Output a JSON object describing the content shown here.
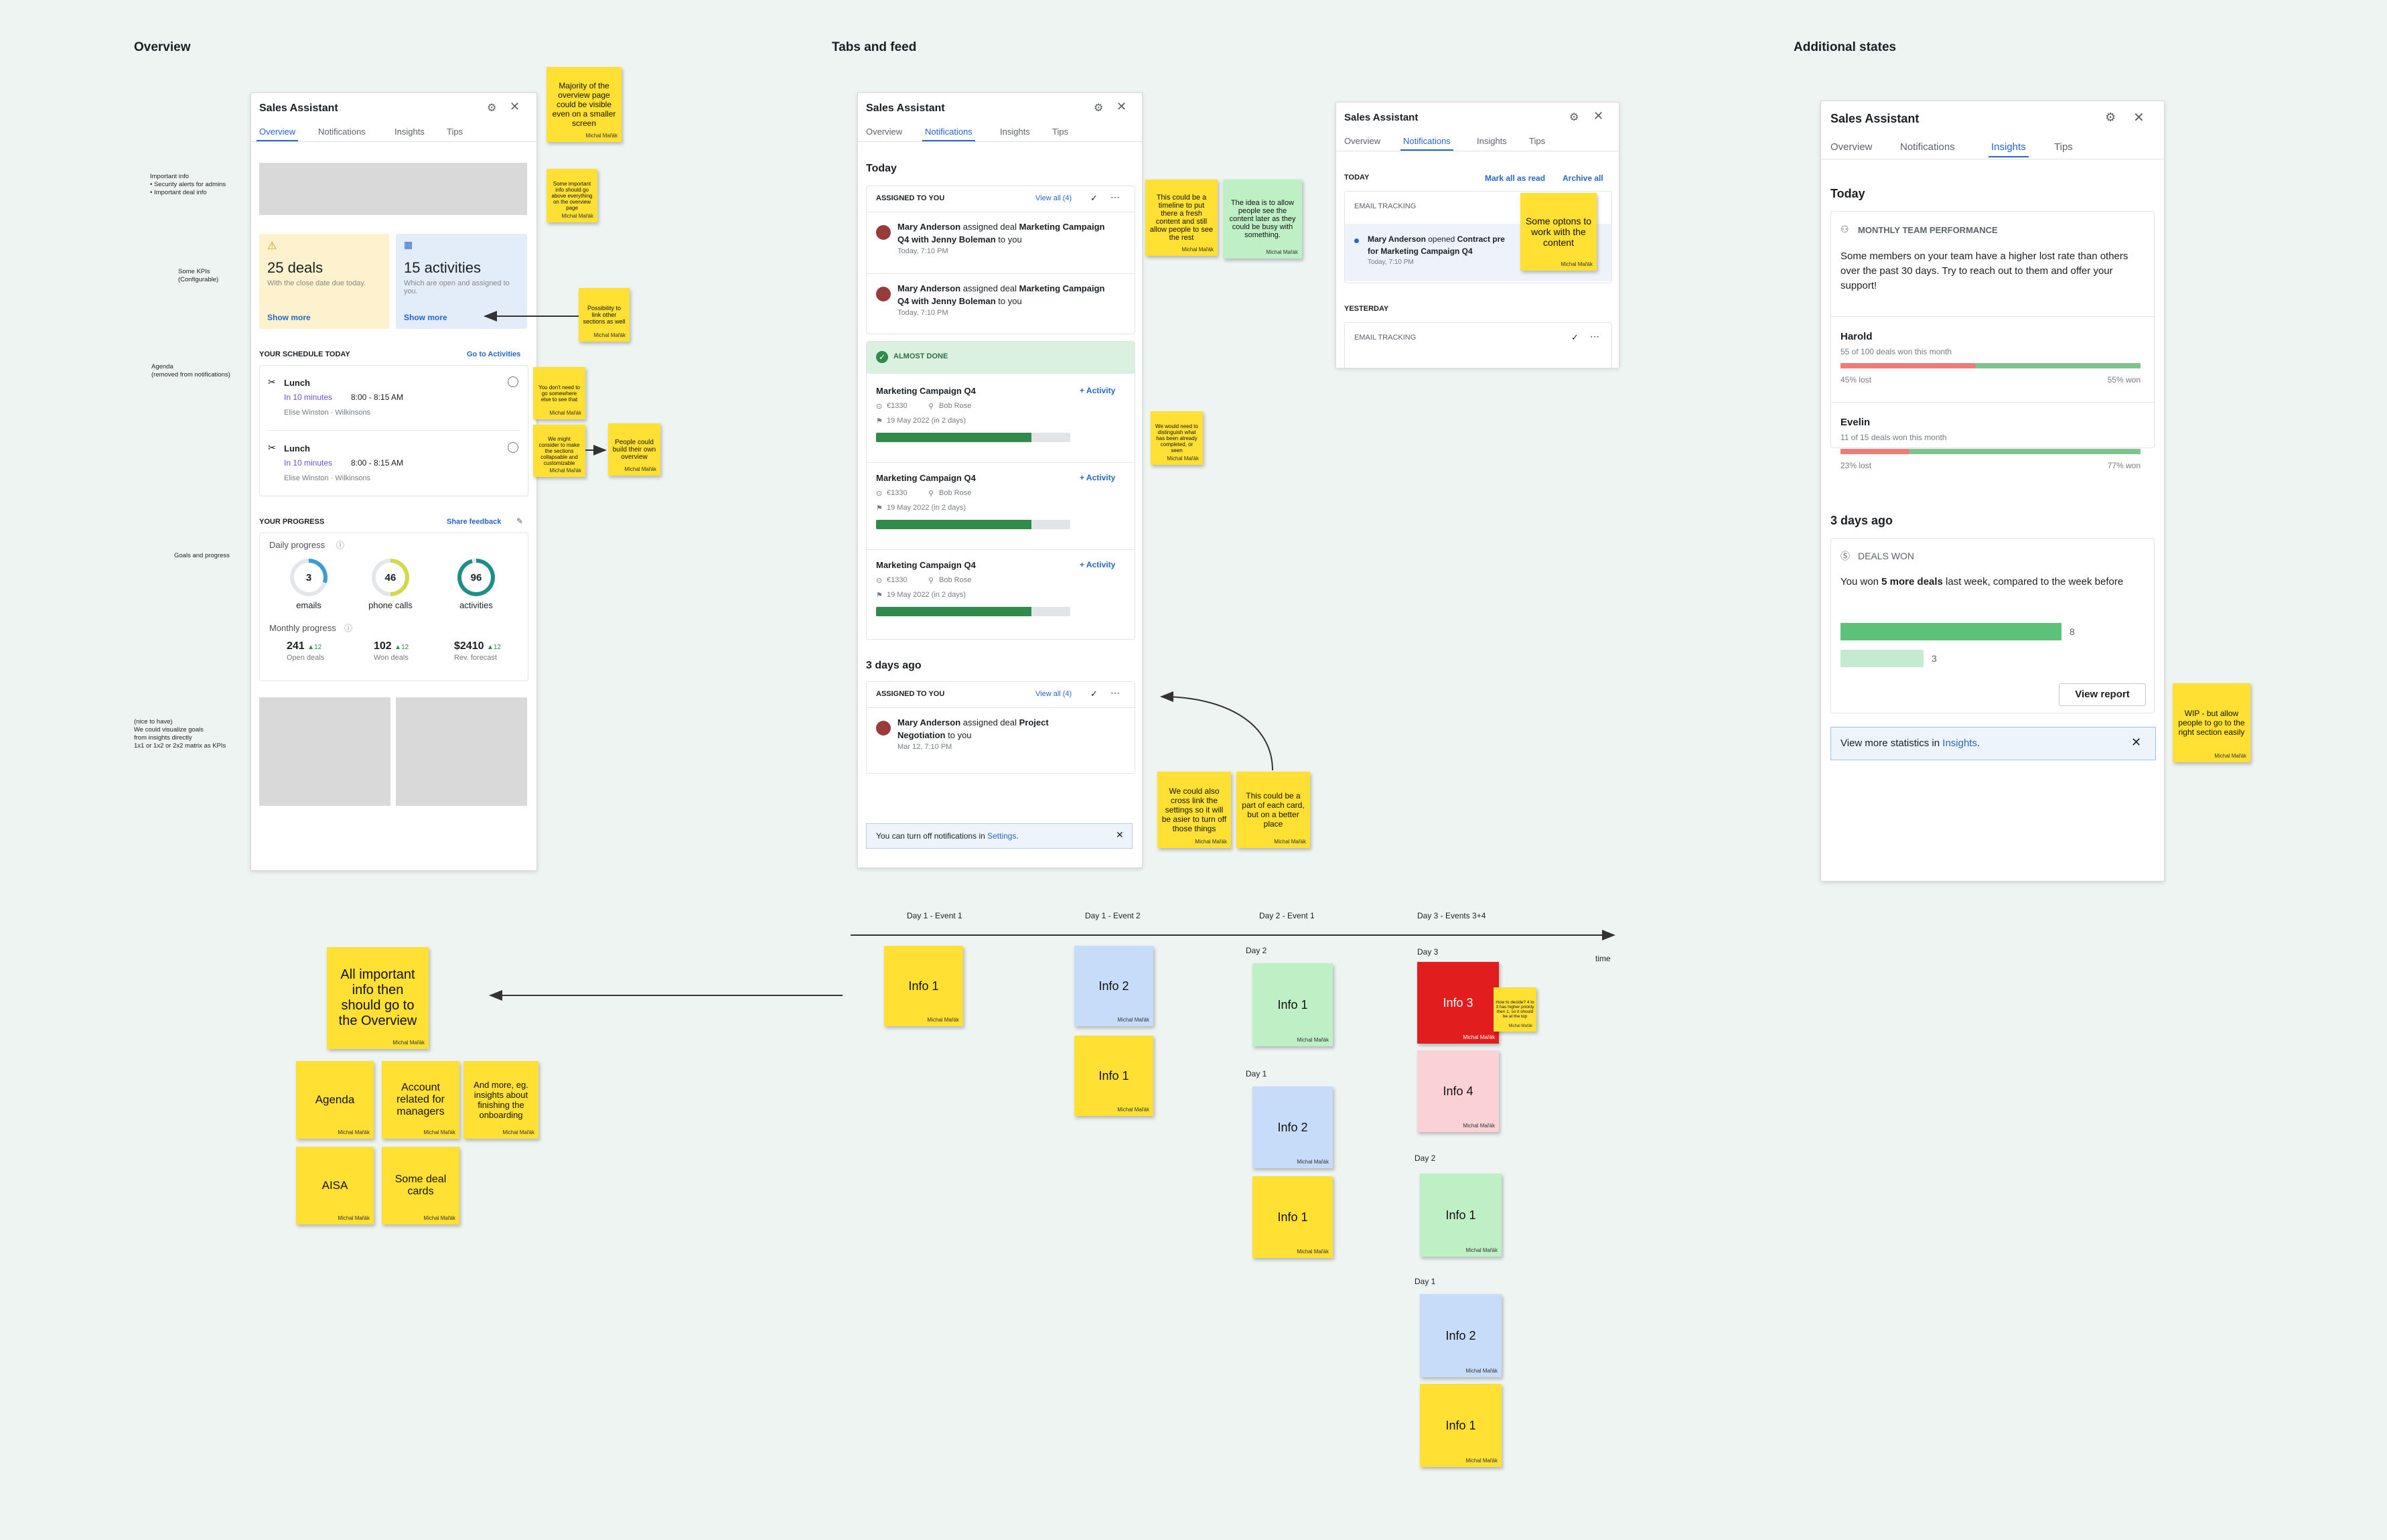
{
  "sections": {
    "overview": "Overview",
    "tabs_feed": "Tabs and feed",
    "additional": "Additional states"
  },
  "margin_notes": {
    "important": "Important info\n• Security alerts for admins\n• Important deal info",
    "kpis": "Some KPIs\n(Configurable)",
    "agenda": "Agenda\n(removed from notifications)",
    "goals": "Goals and progress",
    "nice": "(nice to have)\nWe could visualize goals\nfrom insights directly\n1x1 or 1x2 or 2x2 matrix as KPIs"
  },
  "panel_common": {
    "title": "Sales Assistant",
    "tabs": [
      "Overview",
      "Notifications",
      "Insights",
      "Tips"
    ]
  },
  "overview_panel": {
    "deals_title": "25 deals",
    "deals_sub": "With the close date due today.",
    "deals_link": "Show more",
    "act_title": "15 activities",
    "act_sub": "Which are open and assigned to you.",
    "act_link": "Show more",
    "schedule_title": "YOUR SCHEDULE TODAY",
    "schedule_link": "Go to Activities",
    "schedule": [
      {
        "title": "Lunch",
        "due": "In 10 minutes",
        "time": "8:00 - 8:15 AM",
        "who": "Elise Winston · Wilkinsons"
      },
      {
        "title": "Lunch",
        "due": "In 10 minutes",
        "time": "8:00 - 8:15 AM",
        "who": "Elise Winston · Wilkinsons"
      }
    ],
    "progress_title": "YOUR PROGRESS",
    "progress_link": "Share feedback",
    "daily_label": "Daily progress",
    "daily": [
      {
        "value": "3",
        "label": "emails",
        "color": "#3f9bd8",
        "fraction": 0.3
      },
      {
        "value": "46",
        "label": "phone calls",
        "color": "#cfd94a",
        "fraction": 0.5
      },
      {
        "value": "96",
        "label": "activities",
        "color": "#1f8d8a",
        "fraction": 0.96
      }
    ],
    "monthly_label": "Monthly progress",
    "monthly": [
      {
        "value": "241",
        "delta": "12",
        "label": "Open deals"
      },
      {
        "value": "102",
        "delta": "12",
        "label": "Won deals"
      },
      {
        "value": "$2410",
        "delta": "12",
        "label": "Rev. forecast"
      }
    ]
  },
  "notif_panel": {
    "today": "Today",
    "assigned": "ASSIGNED TO YOU",
    "view_all": "View all (4)",
    "items": [
      {
        "who": "Mary Anderson",
        "mid": " assigned deal ",
        "deal": "Marketing Campaign Q4 with Jenny Boleman",
        "tail": " to you",
        "time": "Today, 7:10 PM"
      },
      {
        "who": "Mary Anderson",
        "mid": " assigned deal ",
        "deal": "Marketing Campaign Q4 with Jenny Boleman",
        "tail": " to you",
        "time": "Today, 7:10 PM"
      }
    ],
    "almost": "ALMOST DONE",
    "deals": [
      {
        "name": "Marketing Campaign Q4",
        "action": "+ Activity",
        "amount": "€1330",
        "owner": "Bob Rose",
        "date": "19 May 2022 (in 2 days)",
        "progress": 0.8
      },
      {
        "name": "Marketing Campaign Q4",
        "action": "+ Activity",
        "amount": "€1330",
        "owner": "Bob Rose",
        "date": "19 May 2022 (in 2 days)",
        "progress": 0.8
      },
      {
        "name": "Marketing Campaign Q4",
        "action": "+ Activity",
        "amount": "€1330",
        "owner": "Bob Rose",
        "date": "19 May 2022 (in 2 days)",
        "progress": 0.8
      }
    ],
    "ago": "3 days ago",
    "old": {
      "who": "Mary Anderson",
      "mid": " assigned deal ",
      "deal": "Project Negotiation",
      "tail": " to you",
      "time": "Mar 12, 7:10 PM"
    },
    "footer_pre": "You can turn off notifications in ",
    "footer_link": "Settings",
    "footer_post": "."
  },
  "email_panel": {
    "today": "TODAY",
    "mark": "Mark all as read",
    "archive": "Archive all",
    "tracking": "EMAIL TRACKING",
    "line_who": "Mary Anderson",
    "line_mid": " opened ",
    "line_deal": "Contract pre",
    "line_rest": "for Marketing Campaign Q4",
    "line_time": "Today, 7:10 PM",
    "yesterday": "YESTERDAY",
    "tracking2": "EMAIL TRACKING"
  },
  "insights_panel": {
    "today": "Today",
    "perf_title": "MONTHLY TEAM PERFORMANCE",
    "perf_text": "Some members on your team have a higher lost rate than others over the past 30 days. Try to reach out to them and offer your support!",
    "people": [
      {
        "name": "Harold",
        "sub": "55 of 100 deals won this month",
        "lost": "45% lost",
        "won": "55% won",
        "lost_fraction": 0.45
      },
      {
        "name": "Evelin",
        "sub": "11 of 15 deals won this month",
        "lost": "23% lost",
        "won": "77% won",
        "lost_fraction": 0.23
      }
    ],
    "ago": "3 days ago",
    "won_title": "DEALS WON",
    "won_pre": "You won ",
    "won_bold": "5 more deals",
    "won_post": " last week, compared to the week before",
    "bars": [
      {
        "value": 8,
        "label": "8",
        "color": "#5cc278"
      },
      {
        "value": 3,
        "label": "3",
        "color": "#c4ead0"
      }
    ],
    "report": "View report",
    "more_pre": "View more statistics in ",
    "more_link": "Insights",
    "more_post": "."
  },
  "stickies": {
    "s1": "Majority of the overview page could be visible even on a smaller screen",
    "s2": "Some important info should go above everything on the overview page",
    "s3": "Possibility to link other sections as well",
    "s4": "You don't need to go somewhere else to see that",
    "s5": "We might consider to make the sections collapsable and customizable",
    "s6": "People could build their own overview",
    "s7": "This could be a timeline to put there a fresh content and still allow people to see the rest",
    "s8": "The idea is to allow people see the content later as they could be busy with something.",
    "s9": "We would need to distinguish what has been already completed, or seen",
    "s10": "We could also cross link the settings so it will be asier to turn off those things",
    "s11": "This could be a part of each card, but on a better place",
    "s12": "Some optons to work with the content",
    "s13": "WIP - but allow people to go to the right section easily",
    "s14": "All important info then should go to the Overview",
    "s15": "Agenda",
    "s16": "Account related for managers",
    "s17": "And more, eg. insights about finishing the onboarding",
    "s18": "AISA",
    "s19": "Some deal cards",
    "s20": "How to decide? 4 to 3 has higher priority then 1, so it should be at the top",
    "author": "Michal Mařák"
  },
  "timeline": {
    "headers": [
      "Day 1 - Event 1",
      "Day 1 - Event 2",
      "Day 2 - Event 1",
      "Day 3 - Events  3+4"
    ],
    "time": "time",
    "labels": {
      "d2": "Day 2",
      "d1": "Day 1",
      "d3": "Day 3"
    },
    "info": [
      "Info 1",
      "Info 2",
      "Info 3",
      "Info 4"
    ]
  }
}
